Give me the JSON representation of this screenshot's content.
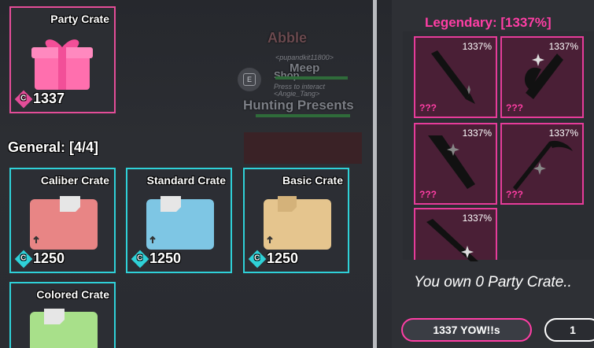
{
  "world": {
    "name_tag": "Abble",
    "user_tag_1": "<pupandkit11800>",
    "meep": "Meep",
    "shop": "Shop",
    "press_hint": "Press to interact",
    "user_tag_2": "<Angie_Tang>",
    "hunting": "Hunting Presents",
    "interact_key": "E"
  },
  "featured_crate": {
    "name": "Party Crate",
    "price": "1337",
    "currency_icon": "pink-gem-icon",
    "accent": "#e44d98"
  },
  "general_section": {
    "label": "General: [4/4]",
    "accent": "#2fd1d8",
    "crates": [
      {
        "name": "Caliber Crate",
        "price": "1250",
        "color": "#e88585"
      },
      {
        "name": "Standard Crate",
        "price": "1250",
        "color": "#7ec6e4"
      },
      {
        "name": "Basic Crate",
        "price": "1250",
        "color": "#e5c58e"
      },
      {
        "name": "Colored Crate",
        "price": "",
        "color": "#a8e08a"
      }
    ]
  },
  "detail_panel": {
    "legendary_label": "Legendary: [1337%]",
    "legendary_color": "#ff3ea5",
    "items": [
      {
        "chance": "1337%",
        "name": "???"
      },
      {
        "chance": "1337%",
        "name": "???"
      },
      {
        "chance": "1337%",
        "name": "???"
      },
      {
        "chance": "1337%",
        "name": "???"
      },
      {
        "chance": "1337%",
        "name": ""
      }
    ],
    "own_text": "You own 0 Party Crate..",
    "buy_button_label": "1337 YOW!!s",
    "quantity_value": "1"
  }
}
